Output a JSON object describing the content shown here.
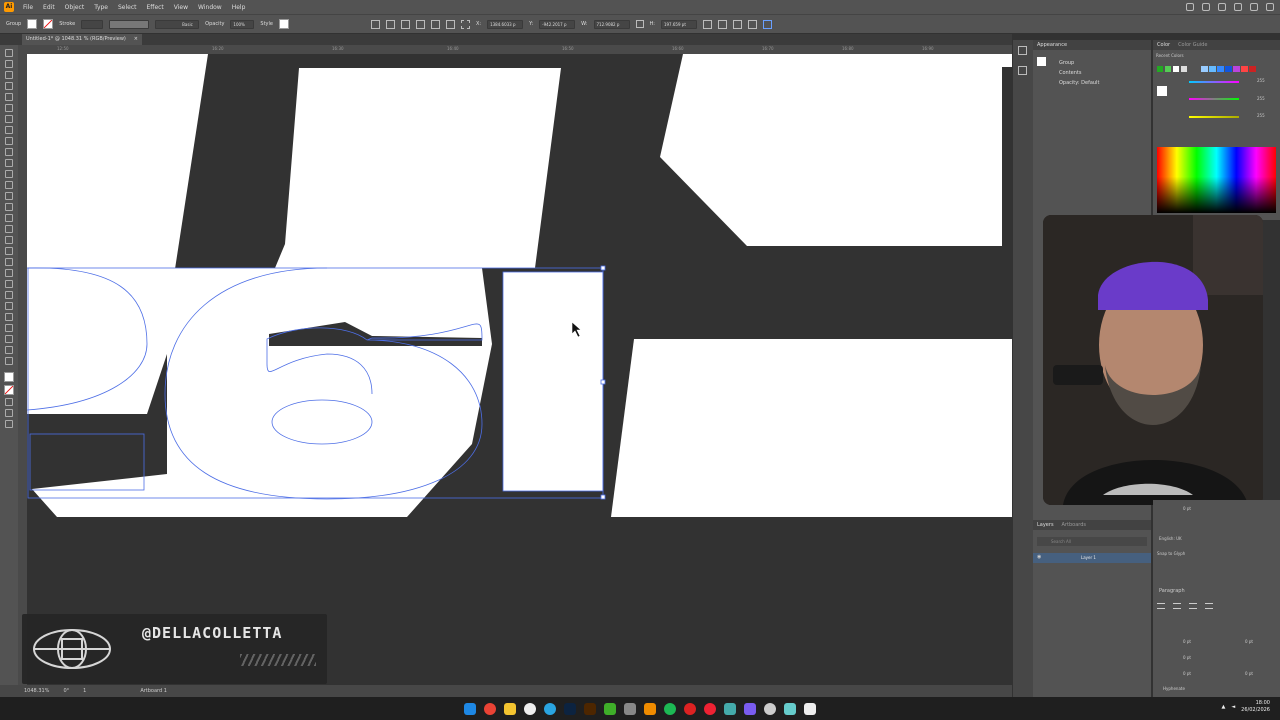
{
  "menubar": {
    "items": [
      "File",
      "Edit",
      "Object",
      "Type",
      "Select",
      "Effect",
      "View",
      "Window",
      "Help"
    ]
  },
  "controlbar": {
    "selection_label": "Group",
    "stroke_label": "Stroke",
    "brush_label": "Basic",
    "opacity_label": "Opacity",
    "opacity_value": "100%",
    "style_label": "Style",
    "x_value": "1384.6033 p",
    "y_value": "-942.2017 p",
    "w_value": "712.9082 p",
    "h_value": "197.659 pt"
  },
  "document": {
    "tab_title": "Untitled-1* @ 1048.31 % (RGB/Preview)",
    "close_glyph": "×",
    "ruler_ticks": [
      "12:50",
      "16:20",
      "16:30",
      "16:40",
      "16:50",
      "16:60",
      "16:70",
      "16:80",
      "16:90"
    ]
  },
  "statusbar": {
    "zoom": "1048.31%",
    "rotation": "0°",
    "artboard_num": "1",
    "artboard_name": "Artboard 1"
  },
  "appearance_panel": {
    "title": "Appearance",
    "group_label": "Group",
    "contents_label": "Contents",
    "opacity_label": "Opacity: Default"
  },
  "color_panel": {
    "tabs": [
      "Color",
      "Color Guide"
    ],
    "recent_label": "Recent Colors",
    "channels": [
      "255",
      "255",
      "255"
    ]
  },
  "layers_panel": {
    "tabs": [
      "Layers",
      "Artboards"
    ],
    "search_placeholder": "Search All",
    "layer_name": "Layer 1"
  },
  "character_panel": {
    "size_value": "0 pt",
    "language": "English: UK",
    "snap_label": "Snap to Glyph",
    "paragraph_label": "Paragraph",
    "indent_values": [
      "0 pt",
      "0 pt",
      "0 pt",
      "0 pt",
      "0 pt"
    ],
    "hyphenate_label": "Hyphenate"
  },
  "overlay": {
    "handle": "@DELLACOLLETTA"
  },
  "taskbar": {
    "time": "18:00",
    "date": "26/02/2026"
  },
  "colors": {
    "artwork": "#ffffff",
    "selection_outline": "#4d6ee6",
    "canvas_bg": "#323232"
  }
}
